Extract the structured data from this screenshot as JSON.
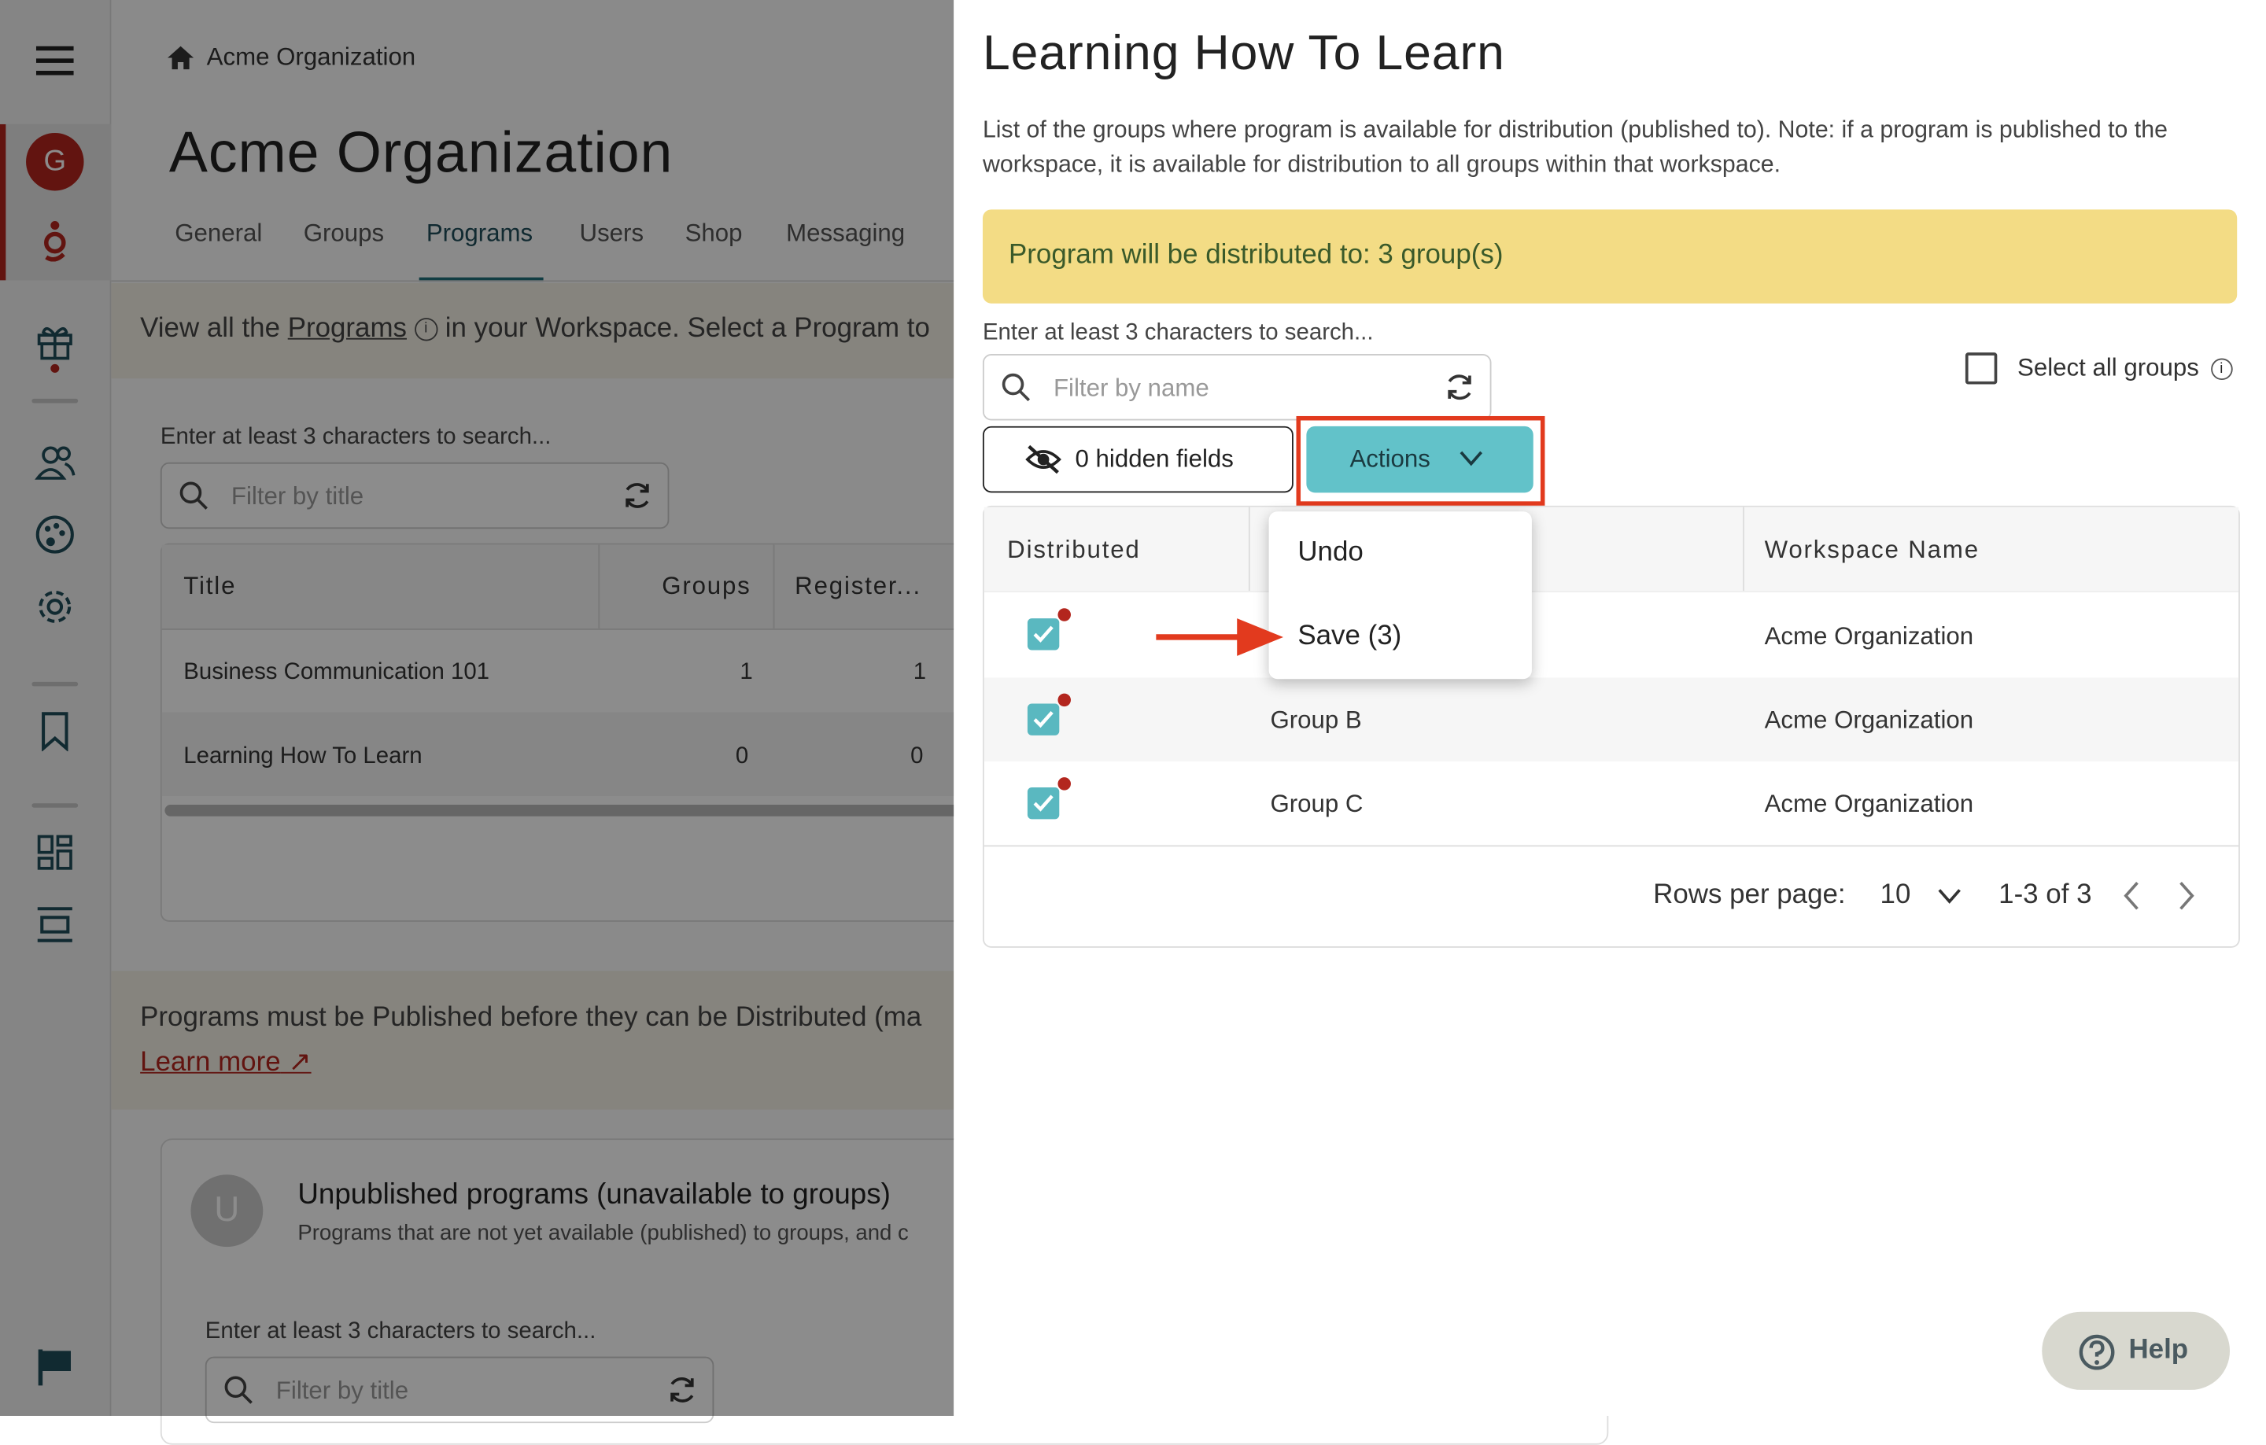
{
  "breadcrumb": {
    "home_label": "Acme Organization"
  },
  "page": {
    "title": "Acme Organization",
    "tabs": [
      "General",
      "Groups",
      "Programs",
      "Users",
      "Shop",
      "Messaging"
    ],
    "active_tab": "Programs",
    "intro_prefix": "View all the",
    "intro_link": "Programs",
    "intro_suffix": "in your Workspace. Select a Program to",
    "search_hint": "Enter at least 3 characters to search...",
    "search_placeholder": "Filter by title",
    "table": {
      "headers": [
        "Title",
        "Groups",
        "Register..."
      ],
      "rows": [
        {
          "title": "Business Communication 101",
          "groups": "1",
          "registered": "1"
        },
        {
          "title": "Learning How To Learn",
          "groups": "0",
          "registered": "0"
        }
      ]
    },
    "notice_text": "Programs must be Published before they can be Distributed (ma",
    "notice_link": "Learn more",
    "unpublished": {
      "avatar_letter": "U",
      "title": "Unpublished programs (unavailable to groups)",
      "subtitle": "Programs that are not yet available (published) to groups, and c",
      "search_hint": "Enter at least 3 characters to search...",
      "search_placeholder": "Filter by title"
    }
  },
  "rail": {
    "avatar_letter": "G",
    "accent": "#b3261e"
  },
  "drawer": {
    "title": "Learning How To Learn",
    "description": "List of the groups where program is available for distribution (published to). Note: if a program is published to the workspace, it is available for distribution to all groups within that workspace.",
    "banner": "Program will be distributed to: 3 group(s)",
    "banner_color": "#f3dc85",
    "search_hint": "Enter at least 3 characters to search...",
    "search_placeholder": "Filter by name",
    "select_all_label": "Select all groups",
    "hidden_fields_label": "0 hidden fields",
    "actions_label": "Actions",
    "actions_color": "#62c2c9",
    "menu": [
      "Undo",
      "Save (3)"
    ],
    "table": {
      "headers": [
        "Distributed",
        "",
        "Workspace Name"
      ],
      "rows": [
        {
          "group": "",
          "workspace": "Acme Organization"
        },
        {
          "group": "Group B",
          "workspace": "Acme Organization"
        },
        {
          "group": "Group C",
          "workspace": "Acme Organization"
        }
      ]
    },
    "pagination": {
      "rows_label": "Rows per page:",
      "rows_value": "10",
      "range": "1-3 of 3"
    }
  },
  "help_label": "Help"
}
